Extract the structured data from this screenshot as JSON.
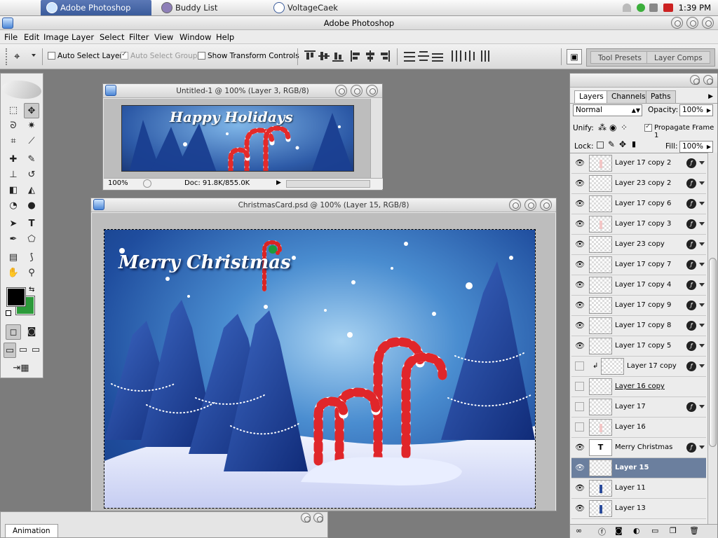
{
  "os": {
    "tabs": [
      {
        "label": "Adobe Photoshop",
        "active": true
      },
      {
        "label": "Buddy List",
        "active": false
      },
      {
        "label": "VoltageCaek",
        "active": false
      }
    ],
    "clock": "1:39 PM"
  },
  "app": {
    "title": "Adobe Photoshop"
  },
  "menu": [
    "File",
    "Edit",
    "Image",
    "Layer",
    "Select",
    "Filter",
    "View",
    "Window",
    "Help"
  ],
  "options": {
    "auto_select_layer": "Auto Select Layer",
    "auto_select_groups": "Auto Select Groups",
    "show_transform_controls": "Show Transform Controls",
    "tool_presets": "Tool Presets",
    "layer_comps": "Layer Comps"
  },
  "doc1": {
    "title": "Untitled-1 @ 100% (Layer 3, RGB/8)",
    "zoom": "100%",
    "doc_info": "Doc: 91.8K/855.0K",
    "banner_text": "Happy Holidays"
  },
  "doc2": {
    "title": "ChristmasCard.psd @ 100% (Layer 15, RGB/8)",
    "card_text": "Merry Christmas"
  },
  "layers": {
    "tabs": [
      "Layers",
      "Channels",
      "Paths"
    ],
    "blend_mode": "Normal",
    "opacity_label": "Opacity:",
    "opacity": "100%",
    "unify_label": "Unify:",
    "propagate": "Propagate Frame 1",
    "lock_label": "Lock:",
    "fill_label": "Fill:",
    "fill": "100%",
    "items": [
      {
        "name": "Layer 17 copy 2",
        "visible": true,
        "fx": true
      },
      {
        "name": "Layer 23 copy 2",
        "visible": true,
        "fx": true
      },
      {
        "name": "Layer 17 copy 6",
        "visible": true,
        "fx": true
      },
      {
        "name": "Layer 17 copy 3",
        "visible": true,
        "fx": true
      },
      {
        "name": "Layer 23 copy",
        "visible": true,
        "fx": true
      },
      {
        "name": "Layer 17 copy 7",
        "visible": true,
        "fx": true
      },
      {
        "name": "Layer 17 copy 4",
        "visible": true,
        "fx": true
      },
      {
        "name": "Layer 17 copy 9",
        "visible": true,
        "fx": true
      },
      {
        "name": "Layer 17 copy 8",
        "visible": true,
        "fx": true
      },
      {
        "name": "Layer 17 copy 5",
        "visible": true,
        "fx": true
      },
      {
        "name": "Layer 17 copy",
        "visible": false,
        "fx": true
      },
      {
        "name": "Layer 16 copy",
        "visible": false,
        "fx": false
      },
      {
        "name": "Layer 17",
        "visible": false,
        "fx": true
      },
      {
        "name": "Layer 16",
        "visible": false,
        "fx": false
      },
      {
        "name": "Merry Christmas",
        "visible": true,
        "fx": true
      },
      {
        "name": "Layer 15",
        "visible": true,
        "fx": false
      },
      {
        "name": "Layer 11",
        "visible": true,
        "fx": false
      },
      {
        "name": "Layer 13",
        "visible": true,
        "fx": false
      }
    ]
  },
  "animation": {
    "tab": "Animation"
  },
  "colors": {
    "accent": "#3a5b9b",
    "selection": "#6b7f9e",
    "bg_color": "#2c9a3a"
  }
}
